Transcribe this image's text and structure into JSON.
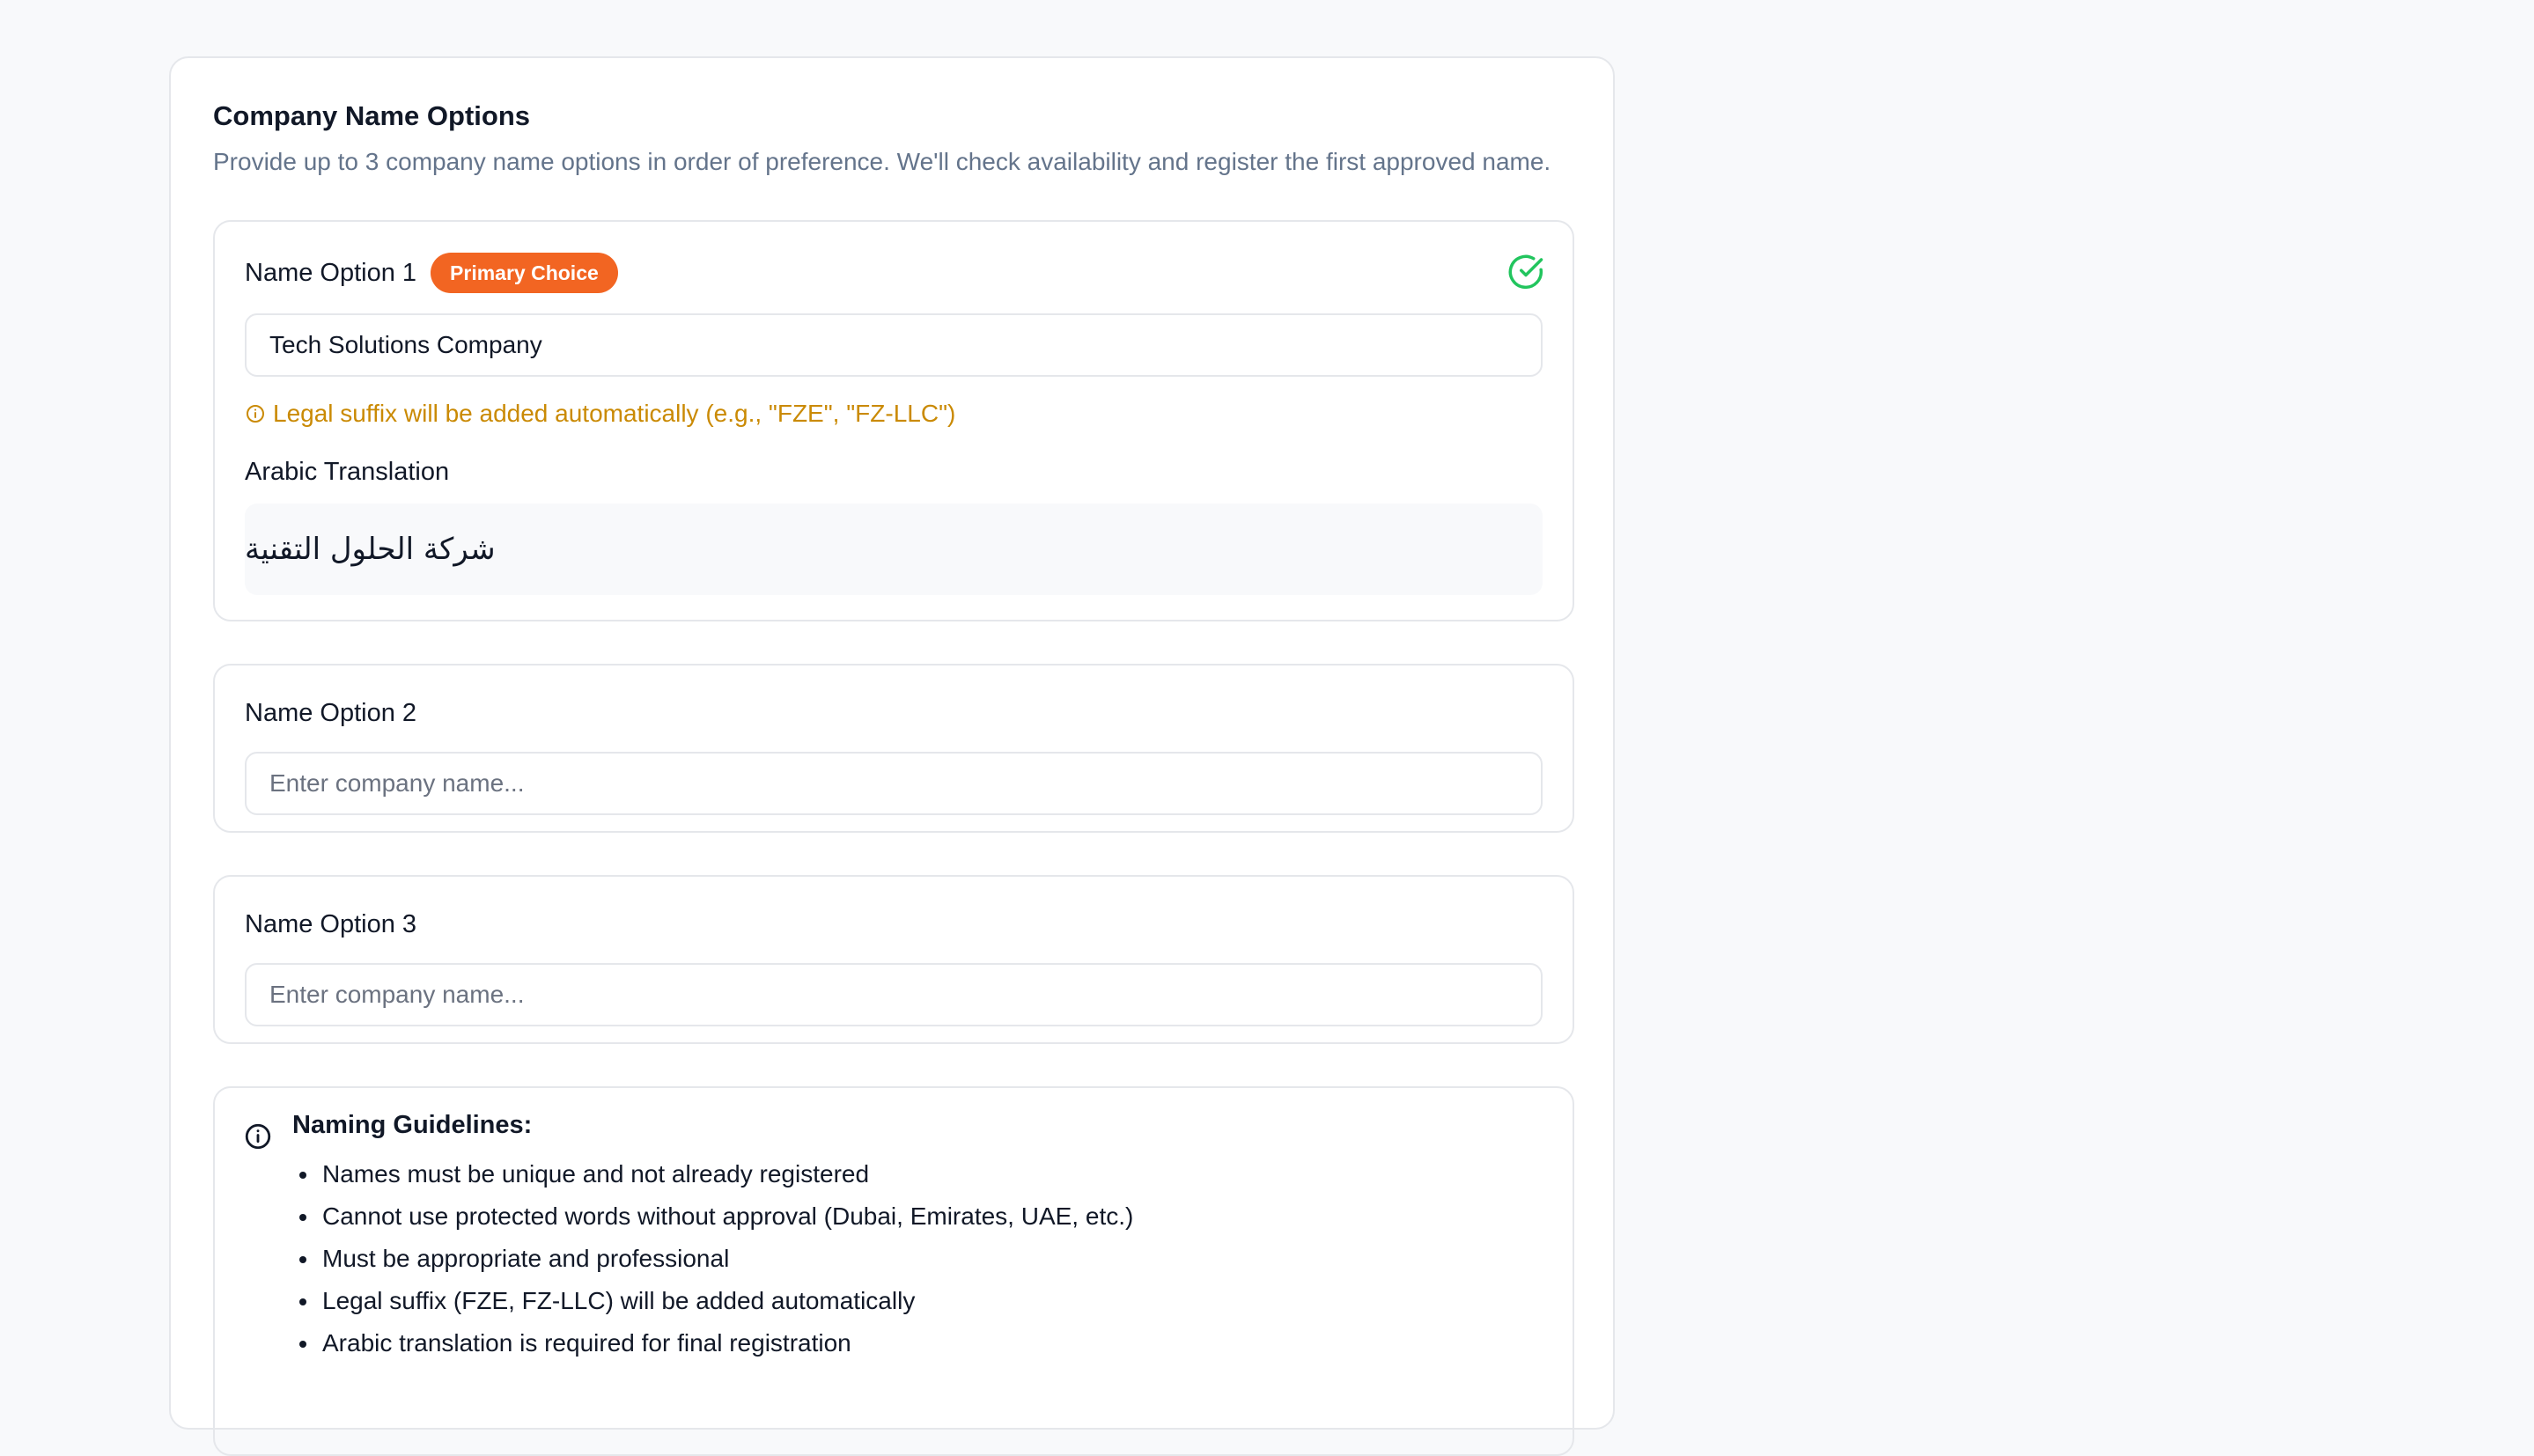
{
  "section": {
    "title": "Company Name Options",
    "description": "Provide up to 3 company name options in order of preference. We'll check availability and register the first approved name."
  },
  "options": [
    {
      "label": "Name Option 1",
      "badge": "Primary Choice",
      "value": "Tech Solutions Company",
      "placeholder": "Enter company name...",
      "hint": "Legal suffix will be added automatically (e.g., \"FZE\", \"FZ-LLC\")",
      "arabic_label": "Arabic Translation",
      "arabic_value": "شركة الحلول التقنية",
      "status_icon": "check-circle-icon"
    },
    {
      "label": "Name Option 2",
      "value": "",
      "placeholder": "Enter company name..."
    },
    {
      "label": "Name Option 3",
      "value": "",
      "placeholder": "Enter company name..."
    }
  ],
  "guidelines": {
    "title": "Naming Guidelines:",
    "items": [
      "Names must be unique and not already registered",
      "Cannot use protected words without approval (Dubai, Emirates, UAE, etc.)",
      "Must be appropriate and professional",
      "Legal suffix (FZE, FZ-LLC) will be added automatically",
      "Arabic translation is required for final registration"
    ]
  },
  "colors": {
    "badge": "#f26522",
    "success": "#22c55e",
    "hint": "#ca8a04",
    "muted": "#64748b"
  }
}
